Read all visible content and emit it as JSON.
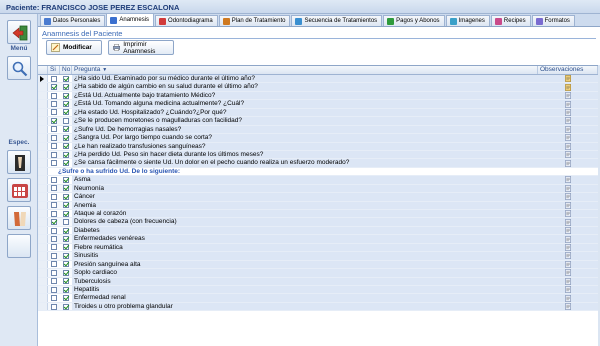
{
  "window": {
    "title": "Paciente: FRANCISCO JOSE PEREZ ESCALONA"
  },
  "left": {
    "labels": {
      "top": "Menú",
      "spec": "Espec."
    },
    "buttons": [
      {
        "name": "back-button",
        "icon": "exit-arrow-icon"
      },
      {
        "name": "search-button",
        "icon": "magnifier-icon"
      },
      {
        "name": "spec-button-1",
        "icon": "dental-xray-icon"
      },
      {
        "name": "spec-button-2",
        "icon": "teeth-model-icon"
      },
      {
        "name": "spec-button-3",
        "icon": "orthodontic-icon"
      },
      {
        "name": "spec-button-4",
        "icon": "blank"
      }
    ]
  },
  "tabs": [
    {
      "label": "Datos Personales",
      "icon": "person-icon",
      "color": "#4a7bd0",
      "active": false
    },
    {
      "label": "Anamnesis",
      "icon": "clipboard-icon",
      "color": "#3a6fcf",
      "active": true
    },
    {
      "label": "Odontodiagrama",
      "icon": "tooth-icon",
      "color": "#d13a3a",
      "active": false
    },
    {
      "label": "Plan de Tratamiento",
      "icon": "plan-icon",
      "color": "#d07a20",
      "active": false
    },
    {
      "label": "Secuencia de Tratamientos",
      "icon": "list-icon",
      "color": "#3a8fd0",
      "active": false
    },
    {
      "label": "Pagos y Abonos",
      "icon": "money-icon",
      "color": "#2f9a3c",
      "active": false
    },
    {
      "label": "Imagenes",
      "icon": "image-icon",
      "color": "#3aa0c8",
      "active": false
    },
    {
      "label": "Recipes",
      "icon": "recipe-icon",
      "color": "#c94a8a",
      "active": false
    },
    {
      "label": "Formatos",
      "icon": "format-icon",
      "color": "#7a6bd0",
      "active": false
    }
  ],
  "main": {
    "section_title": "Anamnesis del Paciente",
    "buttons": {
      "modify": "Modificar",
      "print": "Imprimir Anamnesis"
    },
    "columns": {
      "si": "Si",
      "no": "No",
      "pregunta": "Pregunta",
      "obs": "Observaciones"
    },
    "rows": [
      {
        "q": "¿Ha sido Ud. Examinado por su médico durante el último año?",
        "si": false,
        "no": true,
        "obs": "note-icon-alert",
        "current": true
      },
      {
        "q": "¿Ha sabido de algún cambio en su salud durante el último año?",
        "si": true,
        "no": true,
        "obs": "note-icon-alert"
      },
      {
        "q": "¿Está Ud. Actualmente bajo tratamiento Médico?",
        "si": false,
        "no": true,
        "obs": "note-icon"
      },
      {
        "q": "¿Está Ud. Tomando alguna medicina actualmente? ¿Cuál?",
        "si": false,
        "no": true,
        "obs": "note-icon"
      },
      {
        "q": "¿Ha estado Ud. Hospitalizado? ¿Cuándo?¿Por qué?",
        "si": false,
        "no": true,
        "obs": "note-icon"
      },
      {
        "q": "¿Se le producen moretones o magulladuras con facilidad?",
        "si": true,
        "no": false,
        "obs": "note-icon"
      },
      {
        "q": "¿Sufre Ud. De hemorragias nasales?",
        "si": false,
        "no": true,
        "obs": "note-icon"
      },
      {
        "q": "¿Sangra Ud. Por largo tiempo cuando se corta?",
        "si": false,
        "no": true,
        "obs": "note-icon"
      },
      {
        "q": "¿Le han realizado transfusiones sanguíneas?",
        "si": false,
        "no": true,
        "obs": "note-icon"
      },
      {
        "q": "¿Ha perdido Ud. Peso sin hacer dieta durante los últimos meses?",
        "si": false,
        "no": true,
        "obs": "note-icon"
      },
      {
        "q": "¿Se cansa fácilmente o siente Ud. Un dolor en el pecho cuando realiza un esfuerzo moderado?",
        "si": false,
        "no": true,
        "obs": "note-icon"
      },
      {
        "q": "¿Sufre o ha sufrido Ud. De lo siguiente:",
        "group": true
      },
      {
        "q": "Asma",
        "si": false,
        "no": true,
        "obs": "note-icon"
      },
      {
        "q": "Neumonía",
        "si": false,
        "no": true,
        "obs": "note-icon"
      },
      {
        "q": "Cáncer",
        "si": false,
        "no": true,
        "obs": "note-icon"
      },
      {
        "q": "Anemia",
        "si": false,
        "no": true,
        "obs": "note-icon"
      },
      {
        "q": "Ataque al corazón",
        "si": false,
        "no": true,
        "obs": "note-icon"
      },
      {
        "q": "Dolores de cabeza (con frecuencia)",
        "si": true,
        "no": false,
        "obs": "note-icon"
      },
      {
        "q": "Diabetes",
        "si": false,
        "no": true,
        "obs": "note-icon"
      },
      {
        "q": "Enfermedades venéreas",
        "si": false,
        "no": true,
        "obs": "note-icon"
      },
      {
        "q": "Fiebre reumática",
        "si": false,
        "no": true,
        "obs": "note-icon"
      },
      {
        "q": "Sinusitis",
        "si": false,
        "no": true,
        "obs": "note-icon"
      },
      {
        "q": "Presión sanguínea alta",
        "si": false,
        "no": true,
        "obs": "note-icon"
      },
      {
        "q": "Soplo cardiaco",
        "si": false,
        "no": true,
        "obs": "note-icon"
      },
      {
        "q": "Tuberculosis",
        "si": false,
        "no": true,
        "obs": "note-icon"
      },
      {
        "q": "Hepatitis",
        "si": false,
        "no": true,
        "obs": "note-icon"
      },
      {
        "q": "Enfermedad renal",
        "si": false,
        "no": true,
        "obs": "note-icon"
      },
      {
        "q": "Tiroides u otro problema glandular",
        "si": false,
        "no": true,
        "obs": "note-icon"
      }
    ]
  }
}
